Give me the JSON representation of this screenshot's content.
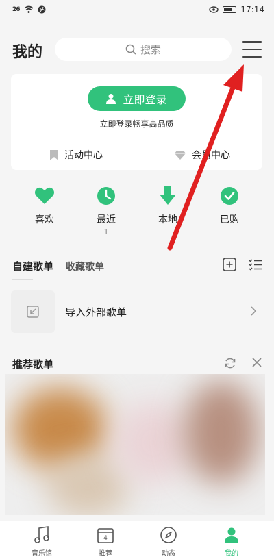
{
  "status_bar": {
    "signal_text": "26",
    "time": "17:14"
  },
  "header": {
    "title": "我的",
    "search_placeholder": "搜索"
  },
  "login_card": {
    "login_button": "立即登录",
    "hint": "立即登录畅享高品质",
    "links": [
      "活动中心",
      "会员中心"
    ]
  },
  "quick_actions": [
    {
      "label": "喜欢",
      "icon": "heart-icon"
    },
    {
      "label": "最近",
      "icon": "clock-icon",
      "count": "1"
    },
    {
      "label": "本地",
      "icon": "download-icon"
    },
    {
      "label": "已购",
      "icon": "check-circle-icon"
    }
  ],
  "playlist_tabs": {
    "active": "自建歌单",
    "inactive": "收藏歌单"
  },
  "import_row": {
    "label": "导入外部歌单"
  },
  "recommended": {
    "title": "推荐歌单"
  },
  "bottom_nav": [
    {
      "label": "音乐馆",
      "icon": "music-note-icon"
    },
    {
      "label": "推荐",
      "icon": "calendar-icon",
      "badge": "4"
    },
    {
      "label": "动态",
      "icon": "compass-icon"
    },
    {
      "label": "我的",
      "icon": "user-icon",
      "active": true
    }
  ],
  "colors": {
    "accent": "#31c27c",
    "annotation_arrow": "#e02020"
  }
}
